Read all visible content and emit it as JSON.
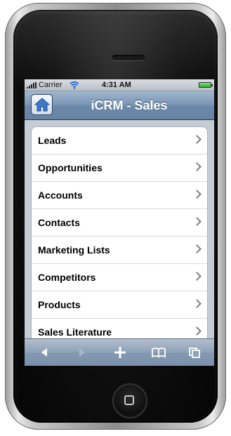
{
  "status_bar": {
    "carrier": "Carrier",
    "time": "4:31 AM",
    "icons": [
      "signal-bars-icon",
      "wifi-icon",
      "battery-icon"
    ]
  },
  "header": {
    "title": "iCRM - Sales",
    "home_icon": "house-icon"
  },
  "menu": {
    "items": [
      {
        "label": "Leads"
      },
      {
        "label": "Opportunities"
      },
      {
        "label": "Accounts"
      },
      {
        "label": "Contacts"
      },
      {
        "label": "Marketing Lists"
      },
      {
        "label": "Competitors"
      },
      {
        "label": "Products"
      },
      {
        "label": "Sales Literature"
      }
    ]
  },
  "toolbar": {
    "buttons": [
      "back-icon",
      "forward-icon",
      "add-icon",
      "bookmarks-icon",
      "pages-icon"
    ]
  },
  "colors": {
    "title_bar": "#7793b3",
    "toolbar": "#8ea1b8",
    "battery": "#2fae2f"
  }
}
